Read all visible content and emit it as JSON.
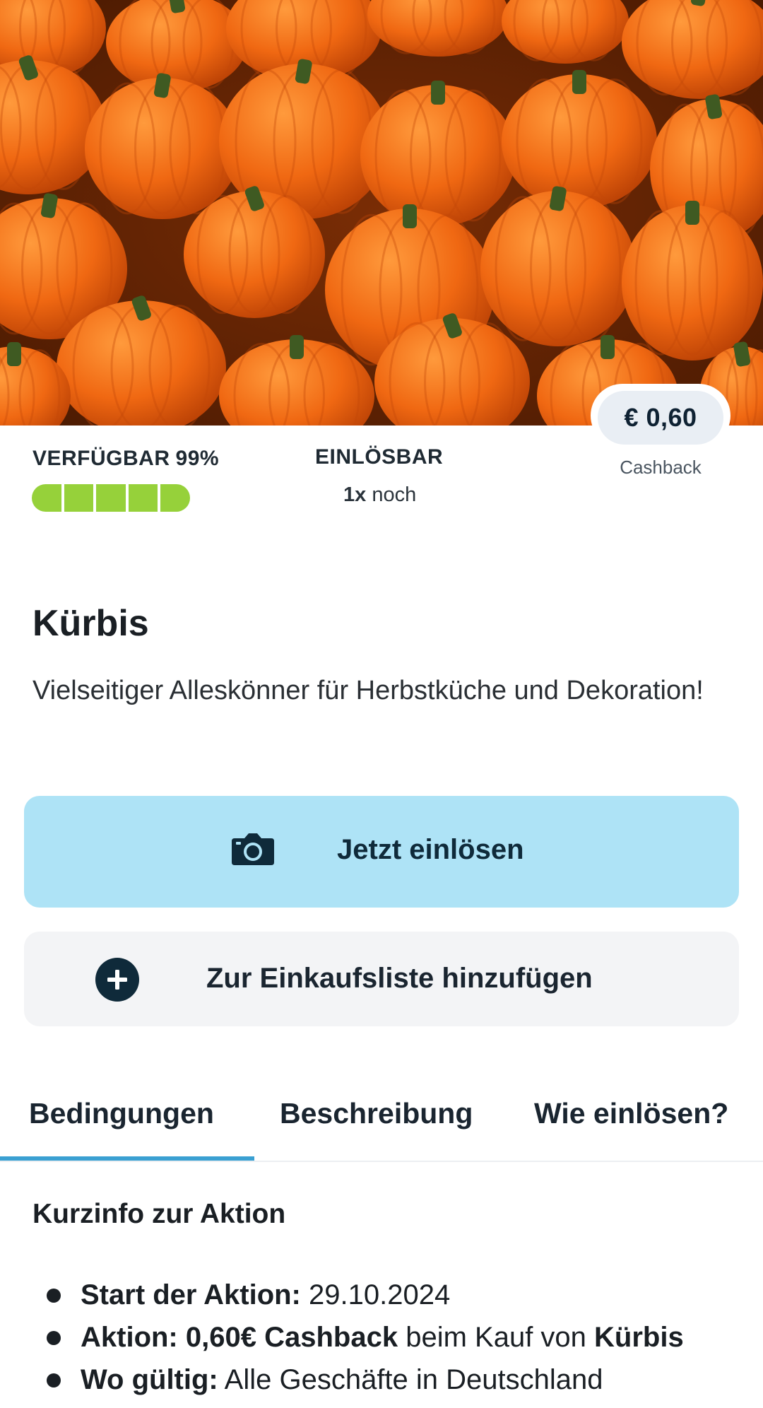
{
  "offer": {
    "cashback_amount": "€ 0,60",
    "cashback_label": "Cashback",
    "availability_label": "VERFÜGBAR",
    "availability_percent": "99%",
    "availability_fraction": 0.99,
    "redeemable_label": "EINLÖSBAR",
    "redeemable_count": "1x",
    "redeemable_suffix": "noch",
    "title": "Kürbis",
    "description": "Vielseitiger Alleskönner für Herbstküche und Dekoration!"
  },
  "actions": {
    "redeem_label": "Jetzt einlösen",
    "redeem_icon": "camera-icon",
    "add_to_list_label": "Zur Einkaufsliste hinzufügen",
    "add_to_list_icon": "plus-circle-icon"
  },
  "tabs": [
    {
      "label": "Bedingungen",
      "active": true
    },
    {
      "label": "Beschreibung",
      "active": false
    },
    {
      "label": "Wie einlösen?",
      "active": false
    }
  ],
  "info": {
    "heading": "Kurzinfo zur Aktion",
    "items": [
      {
        "key": "Start der Aktion:",
        "value": "29.10.2024"
      },
      {
        "key": "Aktion:",
        "value_bold": "0,60€ Cashback",
        "value": "beim Kauf von",
        "value_end": "Kürbis"
      },
      {
        "key": "Wo gültig:",
        "value": "Alle Geschäfte in Deutschland"
      }
    ]
  },
  "colors": {
    "accent_tab": "#3aa0d2",
    "redeem_button": "#aee3f6",
    "availability_bar": "#96d13a",
    "hero_pumpkin": "#f26a10"
  }
}
